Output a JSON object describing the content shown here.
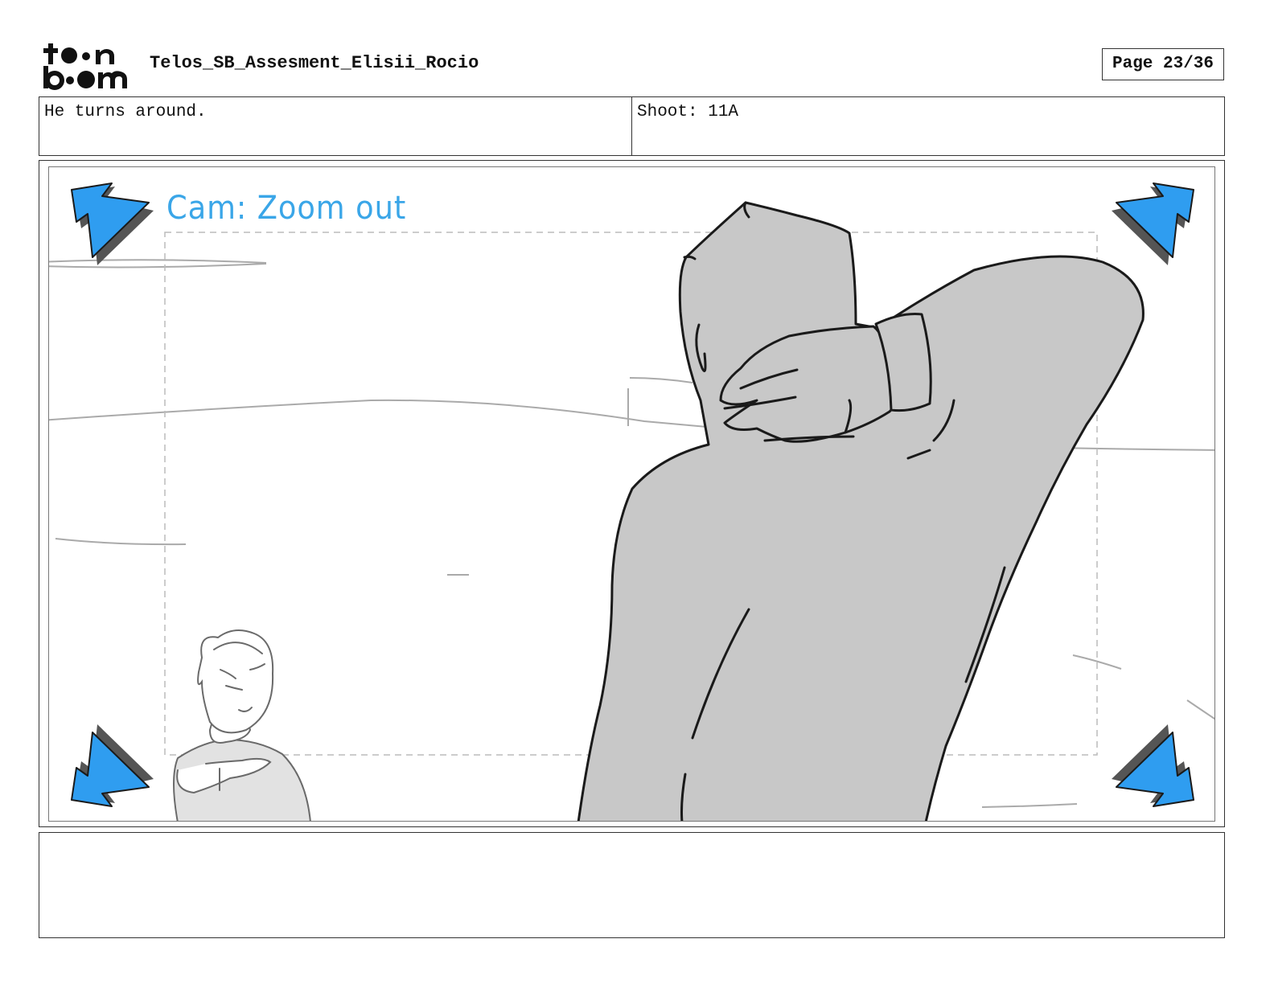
{
  "header": {
    "logo_lines": [
      "toon",
      "boom"
    ],
    "document_title": "Telos_SB_Assesment_Elisii_Rocio",
    "page_label": "Page 23/36"
  },
  "panel_info": {
    "action_text": "He turns around.",
    "shot_text": "Shoot: 11A"
  },
  "panel": {
    "camera_note": "Cam: Zoom out",
    "icons": [
      "zoom-out-arrow-icon"
    ],
    "colors": {
      "annotation_blue": "#3aa6e8",
      "arrow_blue": "#2f9df0",
      "character_fill": "#c9c9c9",
      "sketch_line": "#1a1a1a"
    }
  },
  "notes": {
    "dialogue_text": ""
  }
}
